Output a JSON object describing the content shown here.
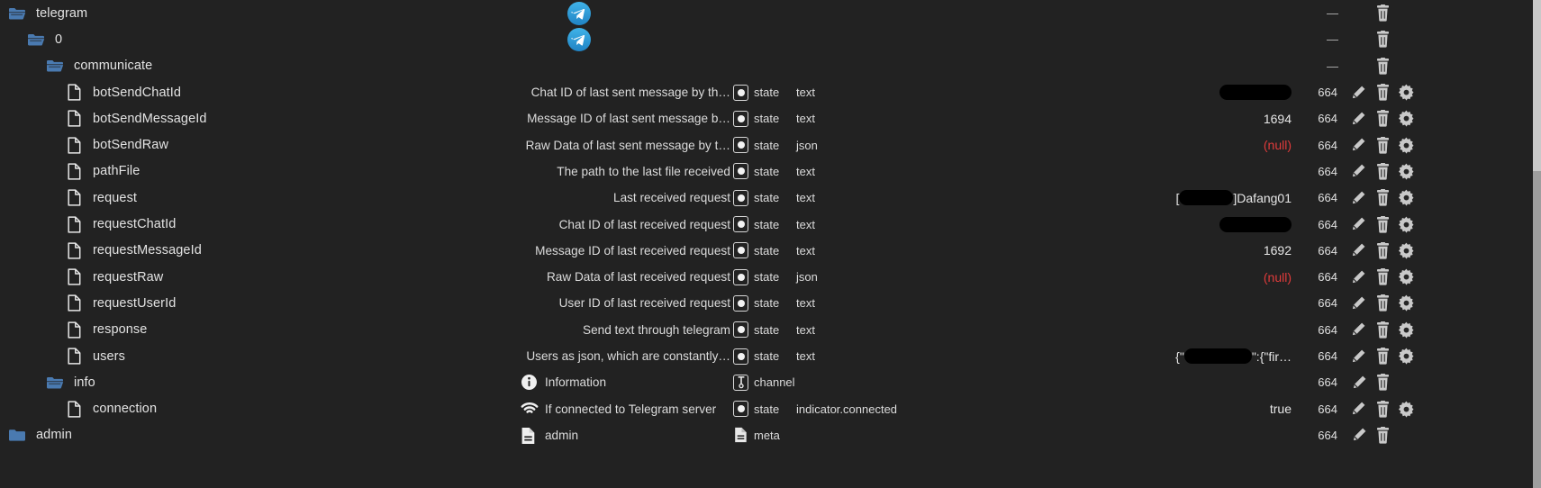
{
  "theme": {
    "background": "#222222",
    "text": "#e3e3e3",
    "folder_color": "#4a7ab0",
    "null_color": "#e03b3b",
    "telegram_blue": "#2ca5e0",
    "icon_gray": "#c9c9c9",
    "redaction": "#000000"
  },
  "scrollbar": {
    "thumb_color": "#c9c9c9",
    "track_color": "#9e9e9e"
  },
  "rows": [
    {
      "indent": 0,
      "icon": "folder-open-icon",
      "name": "telegram",
      "logo": "telegram-icon",
      "desc": "",
      "desc_icon": "",
      "role": "",
      "type": "",
      "value": "",
      "value_kind": "none",
      "perm": "—",
      "perm_dash": true,
      "actions": [
        "trash-icon"
      ]
    },
    {
      "indent": 1,
      "icon": "folder-open-icon",
      "name": "0",
      "logo": "telegram-icon",
      "desc": "",
      "desc_icon": "",
      "role": "",
      "type": "",
      "value": "",
      "value_kind": "none",
      "perm": "—",
      "perm_dash": true,
      "actions": [
        "trash-icon"
      ]
    },
    {
      "indent": 2,
      "icon": "folder-open-icon",
      "name": "communicate",
      "logo": "",
      "desc": "",
      "desc_icon": "",
      "role": "",
      "type": "",
      "value": "",
      "value_kind": "none",
      "perm": "—",
      "perm_dash": true,
      "actions": [
        "trash-icon"
      ]
    },
    {
      "indent": 3,
      "icon": "file-icon",
      "name": "botSendChatId",
      "logo": "",
      "desc": "Chat ID of last sent message by th…",
      "desc_icon": "",
      "role": "state",
      "type": "text",
      "value": "",
      "value_kind": "redacted",
      "redact_width": 80,
      "perm": "664",
      "perm_dash": false,
      "actions": [
        "pencil-icon",
        "trash-icon",
        "gear-icon"
      ]
    },
    {
      "indent": 3,
      "icon": "file-icon",
      "name": "botSendMessageId",
      "logo": "",
      "desc": "Message ID of last sent message b…",
      "desc_icon": "",
      "role": "state",
      "type": "text",
      "value": "1694",
      "value_kind": "text",
      "perm": "664",
      "perm_dash": false,
      "actions": [
        "pencil-icon",
        "trash-icon",
        "gear-icon"
      ]
    },
    {
      "indent": 3,
      "icon": "file-icon",
      "name": "botSendRaw",
      "logo": "",
      "desc": "Raw Data of last sent message by t…",
      "desc_icon": "",
      "role": "state",
      "type": "json",
      "value": "(null)",
      "value_kind": "null",
      "perm": "664",
      "perm_dash": false,
      "actions": [
        "pencil-icon",
        "trash-icon",
        "gear-icon"
      ]
    },
    {
      "indent": 3,
      "icon": "file-icon",
      "name": "pathFile",
      "logo": "",
      "desc": "The path to the last file received",
      "desc_icon": "",
      "role": "state",
      "type": "text",
      "value": "",
      "value_kind": "empty",
      "perm": "664",
      "perm_dash": false,
      "actions": [
        "pencil-icon",
        "trash-icon",
        "gear-icon"
      ]
    },
    {
      "indent": 3,
      "icon": "file-icon",
      "name": "request",
      "logo": "",
      "desc": "Last received request",
      "desc_icon": "",
      "role": "state",
      "type": "text",
      "value": "[█]Dafang01",
      "value_kind": "redacted-mixed",
      "value_prefix": "[",
      "value_suffix": "]Dafang01",
      "redact_width": 60,
      "perm": "664",
      "perm_dash": false,
      "actions": [
        "pencil-icon",
        "trash-icon",
        "gear-icon"
      ]
    },
    {
      "indent": 3,
      "icon": "file-icon",
      "name": "requestChatId",
      "logo": "",
      "desc": "Chat ID of last received request",
      "desc_icon": "",
      "role": "state",
      "type": "text",
      "value": "",
      "value_kind": "redacted",
      "redact_width": 80,
      "perm": "664",
      "perm_dash": false,
      "actions": [
        "pencil-icon",
        "trash-icon",
        "gear-icon"
      ]
    },
    {
      "indent": 3,
      "icon": "file-icon",
      "name": "requestMessageId",
      "logo": "",
      "desc": "Message ID of last received request",
      "desc_icon": "",
      "role": "state",
      "type": "text",
      "value": "1692",
      "value_kind": "text",
      "perm": "664",
      "perm_dash": false,
      "actions": [
        "pencil-icon",
        "trash-icon",
        "gear-icon"
      ]
    },
    {
      "indent": 3,
      "icon": "file-icon",
      "name": "requestRaw",
      "logo": "",
      "desc": "Raw Data of last received request",
      "desc_icon": "",
      "role": "state",
      "type": "json",
      "value": "(null)",
      "value_kind": "null",
      "perm": "664",
      "perm_dash": false,
      "actions": [
        "pencil-icon",
        "trash-icon",
        "gear-icon"
      ]
    },
    {
      "indent": 3,
      "icon": "file-icon",
      "name": "requestUserId",
      "logo": "",
      "desc": "User ID of last received request",
      "desc_icon": "",
      "role": "state",
      "type": "text",
      "value": "",
      "value_kind": "empty",
      "perm": "664",
      "perm_dash": false,
      "actions": [
        "pencil-icon",
        "trash-icon",
        "gear-icon"
      ]
    },
    {
      "indent": 3,
      "icon": "file-icon",
      "name": "response",
      "logo": "",
      "desc": "Send text through telegram",
      "desc_icon": "",
      "role": "state",
      "type": "text",
      "value": "",
      "value_kind": "empty",
      "perm": "664",
      "perm_dash": false,
      "actions": [
        "pencil-icon",
        "trash-icon",
        "gear-icon"
      ]
    },
    {
      "indent": 3,
      "icon": "file-icon",
      "name": "users",
      "logo": "",
      "desc": "Users as json, which are constantly…",
      "desc_icon": "",
      "role": "state",
      "type": "text",
      "value": "{\"█\":{\"fir…",
      "value_kind": "redacted-json",
      "value_prefix": "{\"",
      "value_suffix": "\":{\"fir…",
      "redact_width": 75,
      "perm": "664",
      "perm_dash": false,
      "actions": [
        "pencil-icon",
        "trash-icon",
        "gear-icon"
      ]
    },
    {
      "indent": 2,
      "icon": "folder-open-icon",
      "name": "info",
      "logo": "",
      "desc": "Information",
      "desc_icon": "information-icon",
      "role": "channel",
      "type": "",
      "value": "",
      "value_kind": "empty",
      "perm": "664",
      "perm_dash": false,
      "actions": [
        "pencil-icon",
        "trash-icon"
      ]
    },
    {
      "indent": 3,
      "icon": "file-icon",
      "name": "connection",
      "logo": "",
      "desc": "If connected to Telegram server",
      "desc_icon": "wifi-icon",
      "role": "state",
      "type": "indicator.connected",
      "value": "true",
      "value_kind": "text",
      "perm": "664",
      "perm_dash": false,
      "actions": [
        "pencil-icon",
        "trash-icon",
        "gear-icon"
      ]
    },
    {
      "indent": 0,
      "icon": "folder-closed-icon",
      "name": "admin",
      "logo": "",
      "desc": "admin",
      "desc_icon": "document-lines-icon",
      "role": "meta",
      "type": "",
      "value": "",
      "value_kind": "empty",
      "perm": "664",
      "perm_dash": false,
      "actions": [
        "pencil-icon",
        "trash-icon"
      ]
    }
  ]
}
